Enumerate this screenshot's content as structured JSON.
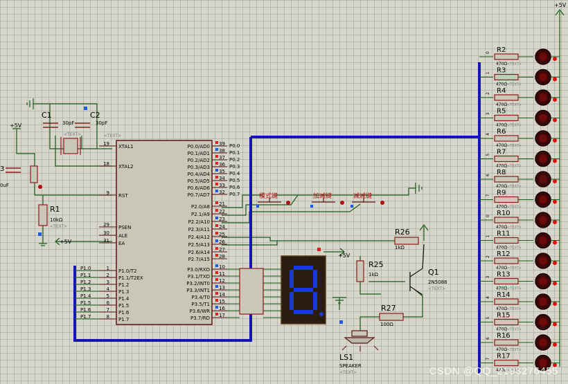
{
  "power": {
    "vcc_left": "+5V",
    "vcc_right": "+5V",
    "vcc_mid": "+5V",
    "vcc_rst": "+5V"
  },
  "crystal": {
    "c1": "C1",
    "c2": "C2",
    "c1_val": "30pF",
    "c2_val": "30pF",
    "text": "<TEXT>"
  },
  "reset": {
    "r1": "R1",
    "r1_val": "10kΩ",
    "text": "<TEXT>",
    "cap_ref": "3",
    "cap_val": "0uF"
  },
  "mcu": {
    "text": "<TEXT>",
    "left_pins": [
      {
        "num": "19",
        "name": "XTAL1"
      },
      {
        "num": "18",
        "name": "XTAL2"
      },
      {
        "num": "9",
        "name": "RST"
      },
      {
        "num": "29",
        "name": "PSEN"
      },
      {
        "num": "30",
        "name": "ALE"
      },
      {
        "num": "31",
        "name": "EA"
      },
      {
        "num": "1",
        "name": "P1.0/T2"
      },
      {
        "num": "2",
        "name": "P1.1/T2EX"
      },
      {
        "num": "3",
        "name": "P1.2"
      },
      {
        "num": "4",
        "name": "P1.3"
      },
      {
        "num": "5",
        "name": "P1.4"
      },
      {
        "num": "6",
        "name": "P1.5"
      },
      {
        "num": "7",
        "name": "P1.6"
      },
      {
        "num": "8",
        "name": "P1.7"
      }
    ],
    "right_pins": [
      {
        "num": "39",
        "name": "P0.0/AD0",
        "net": "P0.0"
      },
      {
        "num": "38",
        "name": "P0.1/AD1",
        "net": "P0.1"
      },
      {
        "num": "37",
        "name": "P0.2/AD2",
        "net": "P0.2"
      },
      {
        "num": "36",
        "name": "P0.3/AD3",
        "net": "P0.3"
      },
      {
        "num": "35",
        "name": "P0.4/AD4",
        "net": "P0.4"
      },
      {
        "num": "34",
        "name": "P0.5/AD5",
        "net": "P0.5"
      },
      {
        "num": "33",
        "name": "P0.6/AD6",
        "net": "P0.6"
      },
      {
        "num": "32",
        "name": "P0.7/AD7",
        "net": "P0.7"
      },
      {
        "num": "21",
        "name": "P2.0/A8"
      },
      {
        "num": "22",
        "name": "P2.1/A9"
      },
      {
        "num": "23",
        "name": "P2.2/A10"
      },
      {
        "num": "24",
        "name": "P2.3/A11"
      },
      {
        "num": "25",
        "name": "P2.4/A12"
      },
      {
        "num": "26",
        "name": "P2.5/A13"
      },
      {
        "num": "27",
        "name": "P2.6/A14"
      },
      {
        "num": "28",
        "name": "P2.7/A15"
      },
      {
        "num": "10",
        "name": "P3.0/RXD"
      },
      {
        "num": "11",
        "name": "P3.1/TXD"
      },
      {
        "num": "12",
        "name": "P3.2/INT0"
      },
      {
        "num": "13",
        "name": "P3.3/INT1"
      },
      {
        "num": "14",
        "name": "P3.4/T0"
      },
      {
        "num": "15",
        "name": "P3.5/T1"
      },
      {
        "num": "16",
        "name": "P3.6/WR"
      },
      {
        "num": "17",
        "name": "P3.7/RD"
      }
    ],
    "p1_nets": [
      "P1.0",
      "P1.1",
      "P1.2",
      "P1.3",
      "P1.4",
      "P1.5",
      "P1.6",
      "P1.7"
    ]
  },
  "keys": [
    "模式键",
    "加减键",
    "减减键"
  ],
  "transistor": {
    "ref": "Q1",
    "part": "2N5088",
    "text": "<TEXT>"
  },
  "resistors_mid": [
    {
      "ref": "R26",
      "val": "1kΩ"
    },
    {
      "ref": "R25",
      "val": "1kΩ"
    },
    {
      "ref": "R27",
      "val": "100Ω"
    }
  ],
  "speaker": {
    "ref": "LS1",
    "part": "SPEAKER",
    "text": "<TEXT>"
  },
  "led_bank": {
    "refs": [
      "R2",
      "R3",
      "R4",
      "R5",
      "R6",
      "R7",
      "R8",
      "R9",
      "R10",
      "R11",
      "R12",
      "R13",
      "R14",
      "R15",
      "R16",
      "R17"
    ],
    "value": "470Ω",
    "text": "<TEXT>",
    "bus_labels": [
      "0",
      "1",
      "2",
      "3",
      "4",
      "5",
      "6",
      "7",
      "0",
      "1",
      "2",
      "3",
      "4",
      "5",
      "6",
      "7"
    ]
  },
  "watermark": "CSDN @QQ_2193276455"
}
